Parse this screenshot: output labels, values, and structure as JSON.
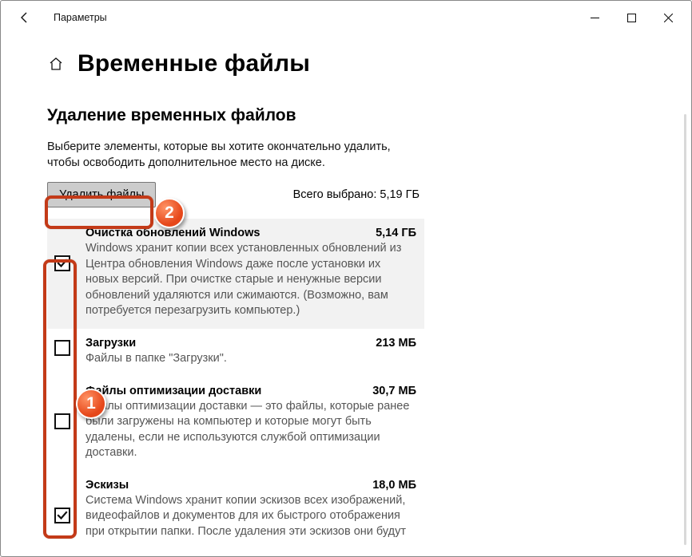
{
  "window": {
    "title": "Параметры"
  },
  "page": {
    "title": "Временные файлы"
  },
  "section": {
    "title": "Удаление временных файлов",
    "intro": "Выберите элементы, которые вы хотите окончательно удалить, чтобы освободить дополнительное место на диске.",
    "remove_button": "Удалить файлы",
    "total_label": "Всего выбрано: 5,19 ГБ"
  },
  "items": [
    {
      "title": "Очистка обновлений Windows",
      "size": "5,14 ГБ",
      "desc": "Windows хранит копии всех установленных обновлений из Центра обновления Windows даже после установки их новых версий. При очистке старые и ненужные версии обновлений удаляются или сжимаются. (Возможно, вам потребуется перезагрузить компьютер.)",
      "checked": true
    },
    {
      "title": "Загрузки",
      "size": "213 МБ",
      "desc": "Файлы в папке \"Загрузки\".",
      "checked": false
    },
    {
      "title": "Файлы оптимизации доставки",
      "size": "30,7 МБ",
      "desc": "Файлы оптимизации доставки — это файлы, которые ранее были загружены на компьютер и которые могут быть удалены, если не используются службой оптимизации доставки.",
      "checked": false
    },
    {
      "title": "Эскизы",
      "size": "18,0 МБ",
      "desc": "Система Windows хранит копии эскизов всех изображений, видеофайлов и документов для их быстрого отображения при открытии папки. После удаления эти эскизов они будут",
      "checked": true
    }
  ],
  "annotations": {
    "badge1": "1",
    "badge2": "2"
  }
}
